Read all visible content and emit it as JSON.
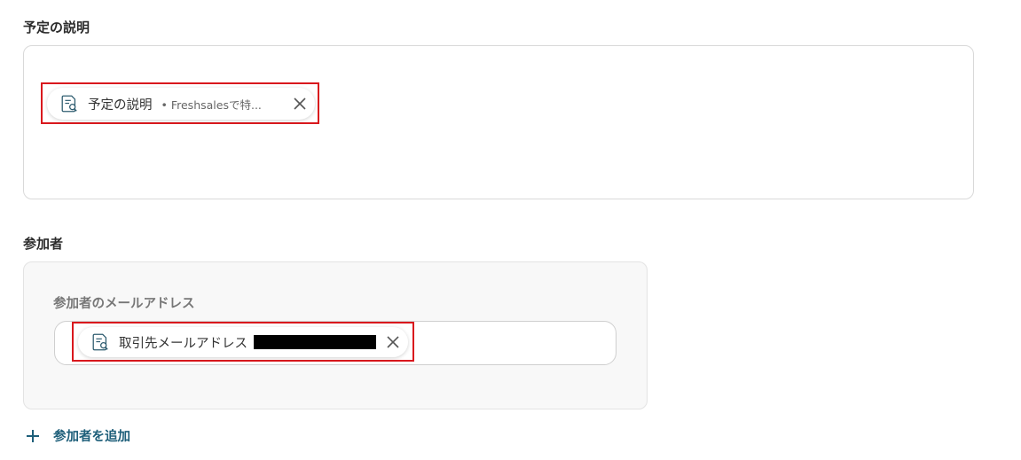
{
  "description": {
    "label": "予定の説明",
    "chip": {
      "icon": "document-search-icon",
      "title": "予定の説明",
      "detail": "• Freshsalesで特...",
      "remove_icon": "close-icon"
    }
  },
  "attendees": {
    "label": "参加者",
    "email": {
      "label": "参加者のメールアドレス",
      "chip": {
        "icon": "document-search-icon",
        "title": "取引先メールアドレス",
        "remove_icon": "close-icon"
      }
    },
    "add_button": {
      "icon": "plus-icon",
      "label": "参加者を追加"
    }
  },
  "colors": {
    "highlight": "#d9181d",
    "link": "#1e5f7a"
  }
}
